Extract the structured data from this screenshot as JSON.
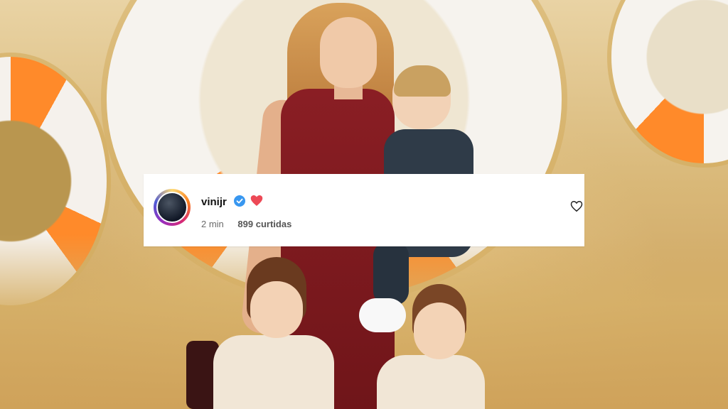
{
  "comment": {
    "username": "vinijr",
    "verified": true,
    "emoji": "heart-emoji",
    "time": "2 min",
    "likes": "899 curtidas"
  },
  "colors": {
    "verified_blue": "#3897f0",
    "heart_red": "#ed4956",
    "ring_orange": "#ff8a2a",
    "backdrop_gold": "#d9b878"
  }
}
